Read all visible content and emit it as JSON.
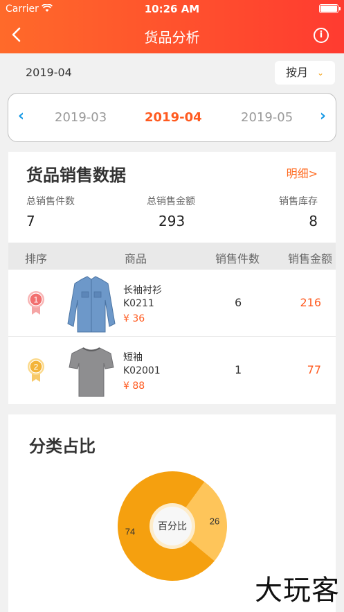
{
  "status": {
    "carrier": "Carrier",
    "time": "10:26 AM"
  },
  "nav": {
    "title": "货品分析"
  },
  "filter": {
    "current_date": "2019-04",
    "mode": "按月"
  },
  "months": {
    "prev": "2019-03",
    "current": "2019-04",
    "next": "2019-05"
  },
  "sales": {
    "title": "货品销售数据",
    "detail_link": "明细>",
    "stats": [
      {
        "label": "总销售件数",
        "value": "7"
      },
      {
        "label": "总销售金额",
        "value": "293"
      },
      {
        "label": "销售库存",
        "value": "8"
      }
    ],
    "columns": [
      "排序",
      "商品",
      "销售件数",
      "销售金额"
    ],
    "rows": [
      {
        "rank": "1",
        "name": "长袖衬衫",
        "code": "K0211",
        "price": "¥ 36",
        "qty": "6",
        "amount": "216",
        "image": "long-sleeve-shirt"
      },
      {
        "rank": "2",
        "name": "短袖",
        "code": "K02001",
        "price": "¥ 88",
        "qty": "1",
        "amount": "77",
        "image": "short-sleeve-tshirt"
      }
    ]
  },
  "category": {
    "title": "分类占比",
    "center_label": "百分比"
  },
  "chart_data": {
    "type": "pie",
    "slices": [
      {
        "value": 74,
        "label": "74",
        "color": "#f5a00f"
      },
      {
        "value": 26,
        "label": "26",
        "color": "#fec55a"
      }
    ],
    "center_label": "百分比"
  },
  "watermark": "大玩客",
  "colors": {
    "accent": "#ff5a1f",
    "header_start": "#ff6a2a",
    "header_end": "#ff3b30",
    "link": "#1a9be6"
  }
}
